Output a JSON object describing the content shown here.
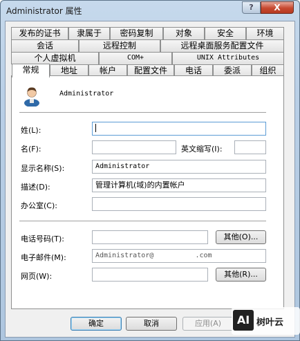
{
  "window": {
    "title": "Administrator 属性",
    "help_button": "?",
    "close_button": "X"
  },
  "tabs": {
    "row1": [
      "发布的证书",
      "隶属于",
      "密码复制",
      "对象",
      "安全",
      "环境"
    ],
    "row2": [
      "会话",
      "远程控制",
      "远程桌面服务配置文件"
    ],
    "row3": [
      "个人虚拟机",
      "COM+",
      "UNIX Attributes"
    ],
    "row4": [
      "常规",
      "地址",
      "帐户",
      "配置文件",
      "电话",
      "委派",
      "组织"
    ],
    "active": "常规"
  },
  "general": {
    "user_name": "Administrator",
    "surname_label": "姓(L):",
    "surname_value": "",
    "given_name_label": "名(F):",
    "given_name_value": "",
    "initials_label": "英文缩写(I):",
    "initials_value": "",
    "display_name_label": "显示名称(S):",
    "display_name_value": "Administrator",
    "description_label": "描述(D):",
    "description_value": "管理计算机(域)的内置帐户",
    "office_label": "办公室(C):",
    "office_value": "",
    "phone_label": "电话号码(T):",
    "phone_value": "",
    "phone_other_button": "其他(O)...",
    "email_label": "电子邮件(M):",
    "email_value": "Administrator@          .com",
    "webpage_label": "网页(W):",
    "webpage_value": "",
    "webpage_other_button": "其他(R)..."
  },
  "footer": {
    "ok": "确定",
    "cancel": "取消",
    "apply": "应用(A)"
  },
  "watermark": {
    "logo": "AI",
    "text": "树叶云"
  },
  "colors": {
    "accent": "#3c7fb1",
    "close": "#c7482f",
    "panel": "#ffffff"
  }
}
